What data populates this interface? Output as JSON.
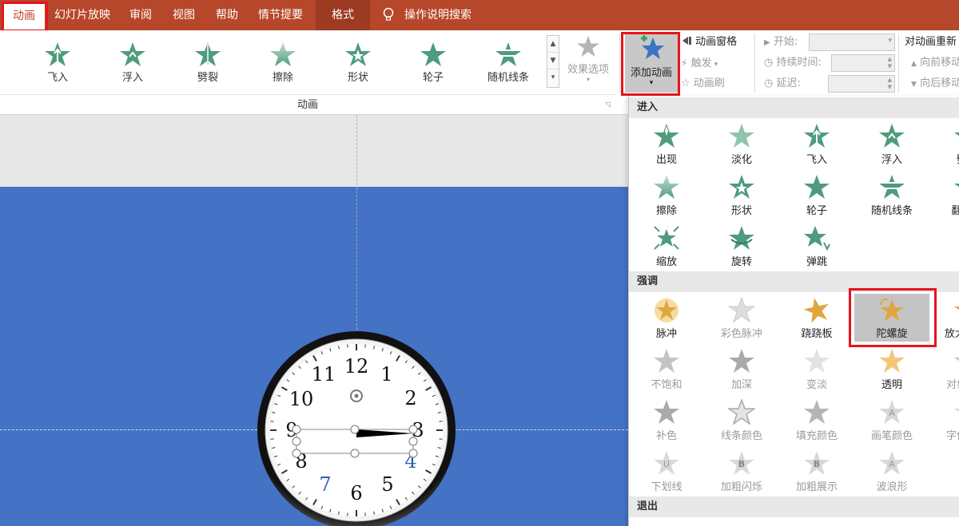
{
  "tabs": [
    {
      "label": "动画",
      "active": true
    },
    {
      "label": "幻灯片放映"
    },
    {
      "label": "审阅"
    },
    {
      "label": "视图"
    },
    {
      "label": "帮助"
    },
    {
      "label": "情节提要"
    },
    {
      "label": "格式"
    },
    {
      "label": "操作说明搜索"
    }
  ],
  "ribbon": {
    "gallery": [
      "飞入",
      "浮入",
      "劈裂",
      "擦除",
      "形状",
      "轮子",
      "随机线条"
    ],
    "effect_options": "效果选项",
    "add_animation": "添加动画",
    "animation_pane": "动画窗格",
    "trigger": "触发",
    "animation_painter": "动画刷",
    "start_label": "开始:",
    "duration_label": "持续时间:",
    "delay_label": "延迟:",
    "reorder_title": "对动画重新",
    "move_earlier": "向前移动",
    "move_later": "向后移动",
    "group_label": "动画"
  },
  "panel": {
    "entrance": {
      "title": "进入",
      "items": [
        "出现",
        "淡化",
        "飞入",
        "浮入",
        "劈裂",
        "擦除",
        "形状",
        "轮子",
        "随机线条",
        "翻转式",
        "缩放",
        "旋转",
        "弹跳"
      ]
    },
    "emphasis": {
      "title": "强调",
      "items": [
        "脉冲",
        "彩色脉冲",
        "跷跷板",
        "陀螺旋",
        "放大/缩小",
        "不饱和",
        "加深",
        "变淡",
        "透明",
        "对象颜色",
        "补色",
        "线条颜色",
        "填充颜色",
        "画笔颜色",
        "字体颜色",
        "下划线",
        "加粗闪烁",
        "加粗展示",
        "波浪形"
      ],
      "selected": "陀螺旋"
    },
    "exit": {
      "title": "退出"
    }
  },
  "clock": {
    "numbers": [
      "12",
      "1",
      "2",
      "3",
      "4",
      "5",
      "6",
      "7",
      "8",
      "9",
      "10",
      "11"
    ],
    "colors": {
      "4": "#2f5fb0",
      "7": "#2f5fb0"
    }
  },
  "colors": {
    "accent": "#b7472a",
    "slide": "#4472c4",
    "highlight": "#e8141c"
  }
}
